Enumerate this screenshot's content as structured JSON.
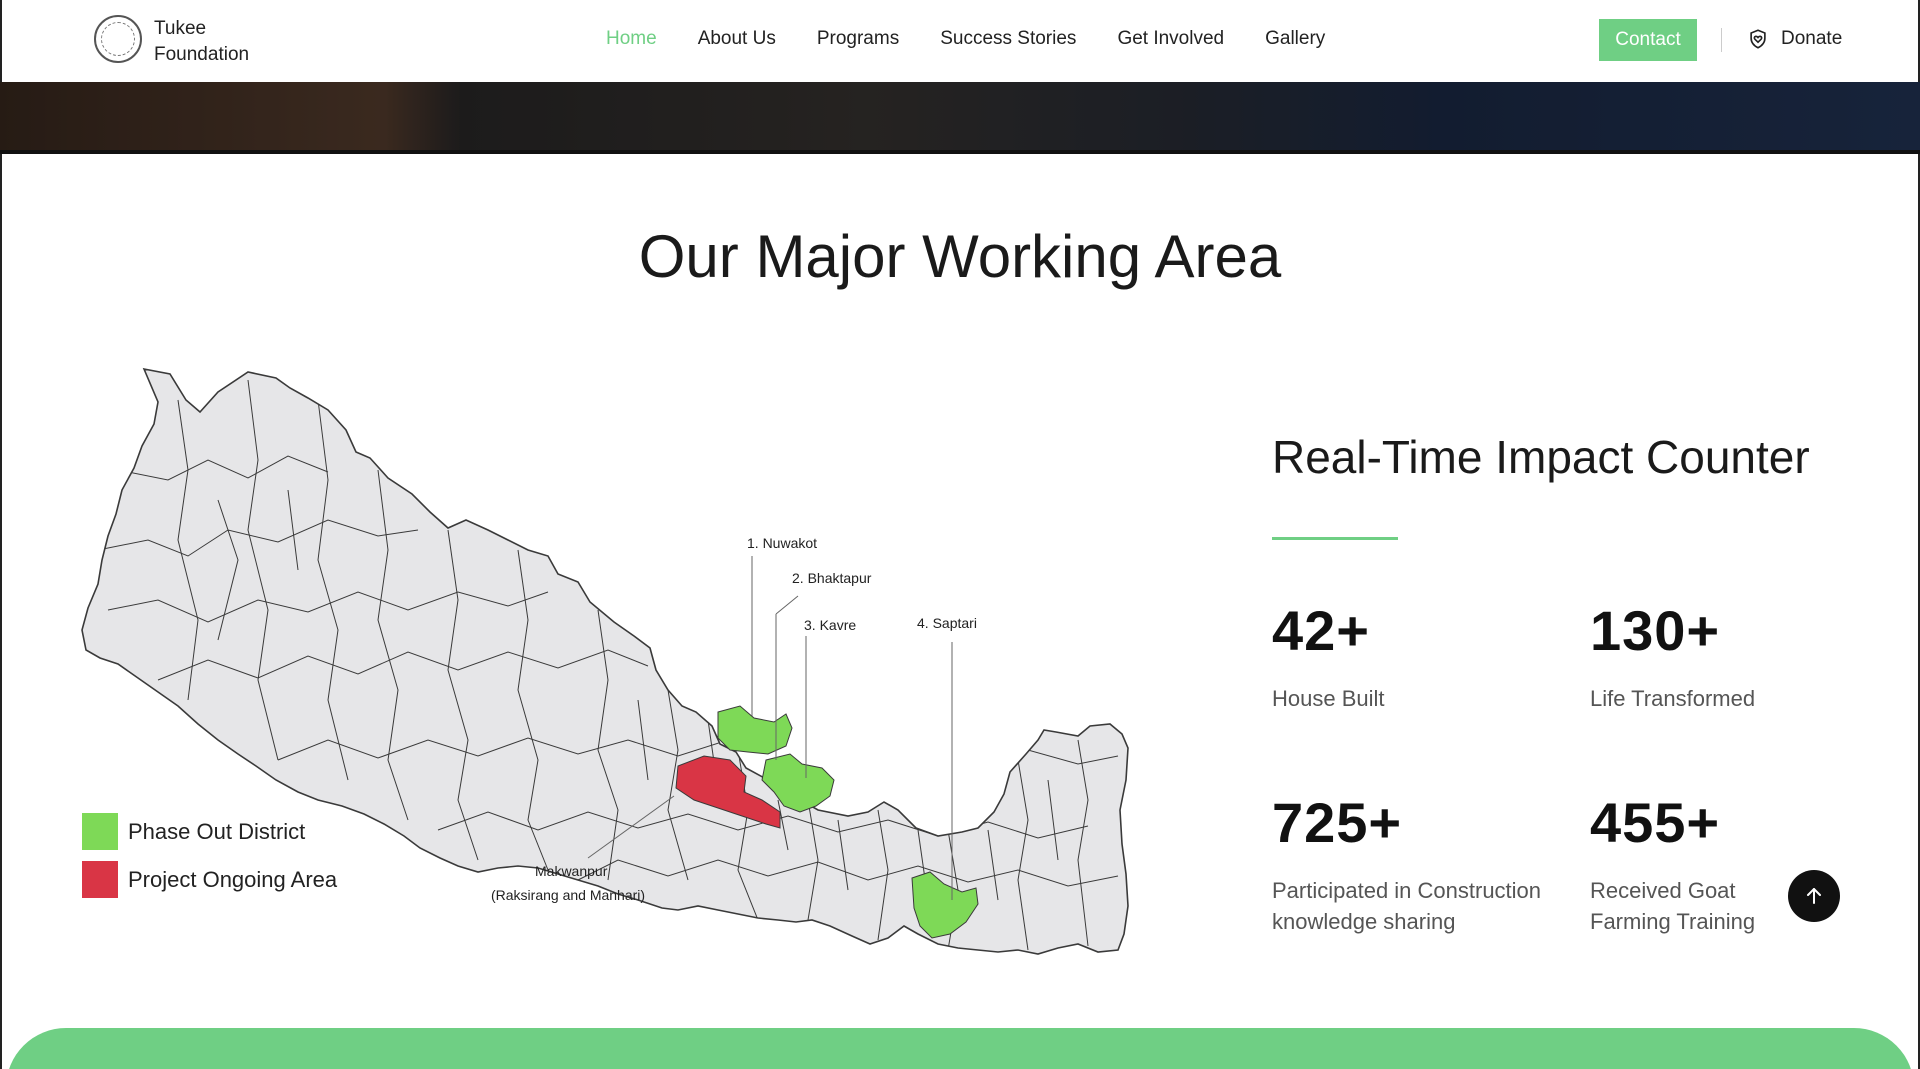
{
  "nav": {
    "brand_line1": "Tukee",
    "brand_line2": "Foundation",
    "items": [
      {
        "label": "Home",
        "active": true
      },
      {
        "label": "About Us",
        "active": false
      },
      {
        "label": "Programs",
        "active": false
      },
      {
        "label": "Success Stories",
        "active": false
      },
      {
        "label": "Get Involved",
        "active": false
      },
      {
        "label": "Gallery",
        "active": false
      }
    ],
    "contact_label": "Contact",
    "donate_label": "Donate",
    "donate_icon": "shield-heart-icon"
  },
  "working_area": {
    "title": "Our  Major Working Area",
    "callouts": {
      "nuwakot": "1. Nuwakot",
      "bhaktapur": "2. Bhaktapur",
      "kavre": "3. Kavre",
      "saptari": "4. Saptari",
      "makwanpur_line1": "Makwanpur",
      "makwanpur_line2": "(Raksirang and  Manhari)"
    },
    "legend": [
      {
        "label": "Phase Out  District",
        "color": "#7ed957"
      },
      {
        "label": "Project Ongoing Area",
        "color": "#d93545"
      }
    ],
    "map_fill": "#e6e6e8",
    "map_stroke": "#3a3a3a"
  },
  "impact": {
    "title": "Real-Time  Impact Counter",
    "accent": "#6fcf84",
    "stats": [
      {
        "value": "42+",
        "label_line1": "House  Built",
        "label_line2": ""
      },
      {
        "value": "130+",
        "label_line1": "Life Transformed",
        "label_line2": ""
      },
      {
        "value": "725+",
        "label_line1": "Participated in Construction",
        "label_line2": "knowledge sharing"
      },
      {
        "value": "455+",
        "label_line1": "Received Goat",
        "label_line2": "Farming Training"
      }
    ]
  },
  "scroll_top_icon": "arrow-up-icon"
}
